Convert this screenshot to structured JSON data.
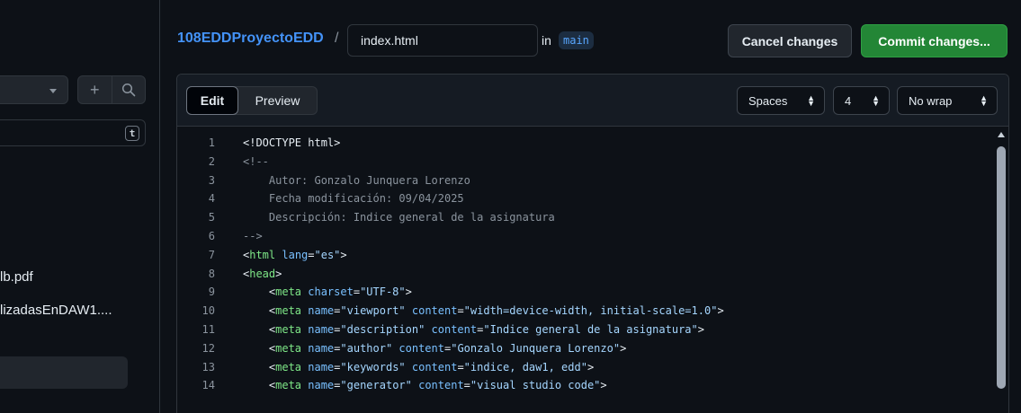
{
  "sidebar": {
    "search_shortcut": "t",
    "files": [
      "lb.pdf",
      "lizadasEnDAW1...."
    ]
  },
  "header": {
    "repo": "108EDDProyectoEDD",
    "separator": "/",
    "filename": "index.html",
    "in_label": "in",
    "branch": "main",
    "cancel_label": "Cancel changes",
    "commit_label": "Commit changes..."
  },
  "editor": {
    "tabs": {
      "edit": "Edit",
      "preview": "Preview"
    },
    "indent_mode": "Spaces",
    "indent_size": "4",
    "wrap_mode": "No wrap"
  },
  "code_lines": [
    {
      "n": "1",
      "parts": [
        [
          "<!DOCTYPE html>",
          "text"
        ]
      ]
    },
    {
      "n": "2",
      "parts": [
        [
          "<!--",
          "comment"
        ]
      ]
    },
    {
      "n": "3",
      "parts": [
        [
          "    Autor: Gonzalo Junquera Lorenzo",
          "comment"
        ]
      ]
    },
    {
      "n": "4",
      "parts": [
        [
          "    Fecha modificación: 09/04/2025",
          "comment"
        ]
      ]
    },
    {
      "n": "5",
      "parts": [
        [
          "    Descripción: Indice general de la asignatura",
          "comment"
        ]
      ]
    },
    {
      "n": "6",
      "parts": [
        [
          "-->",
          "comment"
        ]
      ]
    },
    {
      "n": "7",
      "parts": [
        [
          "<",
          "text"
        ],
        [
          "html",
          "tag"
        ],
        [
          " lang",
          "attr"
        ],
        [
          "=",
          "text"
        ],
        [
          "\"es\"",
          "str"
        ],
        [
          ">",
          "text"
        ]
      ]
    },
    {
      "n": "8",
      "parts": [
        [
          "<",
          "text"
        ],
        [
          "head",
          "tag"
        ],
        [
          ">",
          "text"
        ]
      ]
    },
    {
      "n": "9",
      "parts": [
        [
          "    <",
          "text"
        ],
        [
          "meta",
          "tag"
        ],
        [
          " charset",
          "attr"
        ],
        [
          "=",
          "text"
        ],
        [
          "\"UTF-8\"",
          "str"
        ],
        [
          ">",
          "text"
        ]
      ]
    },
    {
      "n": "10",
      "parts": [
        [
          "    <",
          "text"
        ],
        [
          "meta",
          "tag"
        ],
        [
          " name",
          "attr"
        ],
        [
          "=",
          "text"
        ],
        [
          "\"viewport\"",
          "str"
        ],
        [
          " content",
          "attr"
        ],
        [
          "=",
          "text"
        ],
        [
          "\"width=device-width, initial-scale=1.0\"",
          "str"
        ],
        [
          ">",
          "text"
        ]
      ]
    },
    {
      "n": "11",
      "parts": [
        [
          "    <",
          "text"
        ],
        [
          "meta",
          "tag"
        ],
        [
          " name",
          "attr"
        ],
        [
          "=",
          "text"
        ],
        [
          "\"description\"",
          "str"
        ],
        [
          " content",
          "attr"
        ],
        [
          "=",
          "text"
        ],
        [
          "\"Indice general de la asignatura\"",
          "str"
        ],
        [
          ">",
          "text"
        ]
      ]
    },
    {
      "n": "12",
      "parts": [
        [
          "    <",
          "text"
        ],
        [
          "meta",
          "tag"
        ],
        [
          " name",
          "attr"
        ],
        [
          "=",
          "text"
        ],
        [
          "\"author\"",
          "str"
        ],
        [
          " content",
          "attr"
        ],
        [
          "=",
          "text"
        ],
        [
          "\"Gonzalo Junquera Lorenzo\"",
          "str"
        ],
        [
          ">",
          "text"
        ]
      ]
    },
    {
      "n": "13",
      "parts": [
        [
          "    <",
          "text"
        ],
        [
          "meta",
          "tag"
        ],
        [
          " name",
          "attr"
        ],
        [
          "=",
          "text"
        ],
        [
          "\"keywords\"",
          "str"
        ],
        [
          " content",
          "attr"
        ],
        [
          "=",
          "text"
        ],
        [
          "\"indice, daw1, edd\"",
          "str"
        ],
        [
          ">",
          "text"
        ]
      ]
    },
    {
      "n": "14",
      "parts": [
        [
          "    <",
          "text"
        ],
        [
          "meta",
          "tag"
        ],
        [
          " name",
          "attr"
        ],
        [
          "=",
          "text"
        ],
        [
          "\"generator\"",
          "str"
        ],
        [
          " content",
          "attr"
        ],
        [
          "=",
          "text"
        ],
        [
          "\"visual studio code\"",
          "str"
        ],
        [
          ">",
          "text"
        ]
      ]
    }
  ],
  "colors": {
    "accent_link": "#4493f8",
    "commit_green": "#238636",
    "background": "#0d1117"
  }
}
